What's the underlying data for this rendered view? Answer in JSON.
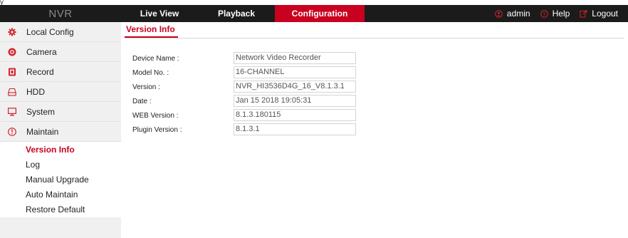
{
  "corner_mark": "y",
  "header": {
    "brand": "NVR",
    "nav": [
      {
        "label": "Live View"
      },
      {
        "label": "Playback"
      },
      {
        "label": "Configuration"
      }
    ],
    "user": "admin",
    "help": "Help",
    "logout": "Logout",
    "accent_color": "#c9001f"
  },
  "sidebar": {
    "items": [
      {
        "label": "Local Config",
        "icon": "gear-icon"
      },
      {
        "label": "Camera",
        "icon": "camera-icon"
      },
      {
        "label": "Record",
        "icon": "record-icon"
      },
      {
        "label": "HDD",
        "icon": "hdd-icon"
      },
      {
        "label": "System",
        "icon": "monitor-icon"
      },
      {
        "label": "Maintain",
        "icon": "info-icon"
      }
    ],
    "sub_items": [
      {
        "label": "Version Info"
      },
      {
        "label": "Log"
      },
      {
        "label": "Manual Upgrade"
      },
      {
        "label": "Auto Maintain"
      },
      {
        "label": "Restore Default"
      }
    ]
  },
  "main": {
    "tab": "Version Info",
    "fields": [
      {
        "label": "Device Name :",
        "value": "Network Video Recorder"
      },
      {
        "label": "Model No. :",
        "value": "16-CHANNEL"
      },
      {
        "label": "Version :",
        "value": "NVR_HI3536D4G_16_V8.1.3.1"
      },
      {
        "label": "Date :",
        "value": "Jan 15 2018   19:05:31"
      },
      {
        "label": "WEB Version :",
        "value": "8.1.3.180115"
      },
      {
        "label": "Plugin Version :",
        "value": "8.1.3.1"
      }
    ]
  }
}
